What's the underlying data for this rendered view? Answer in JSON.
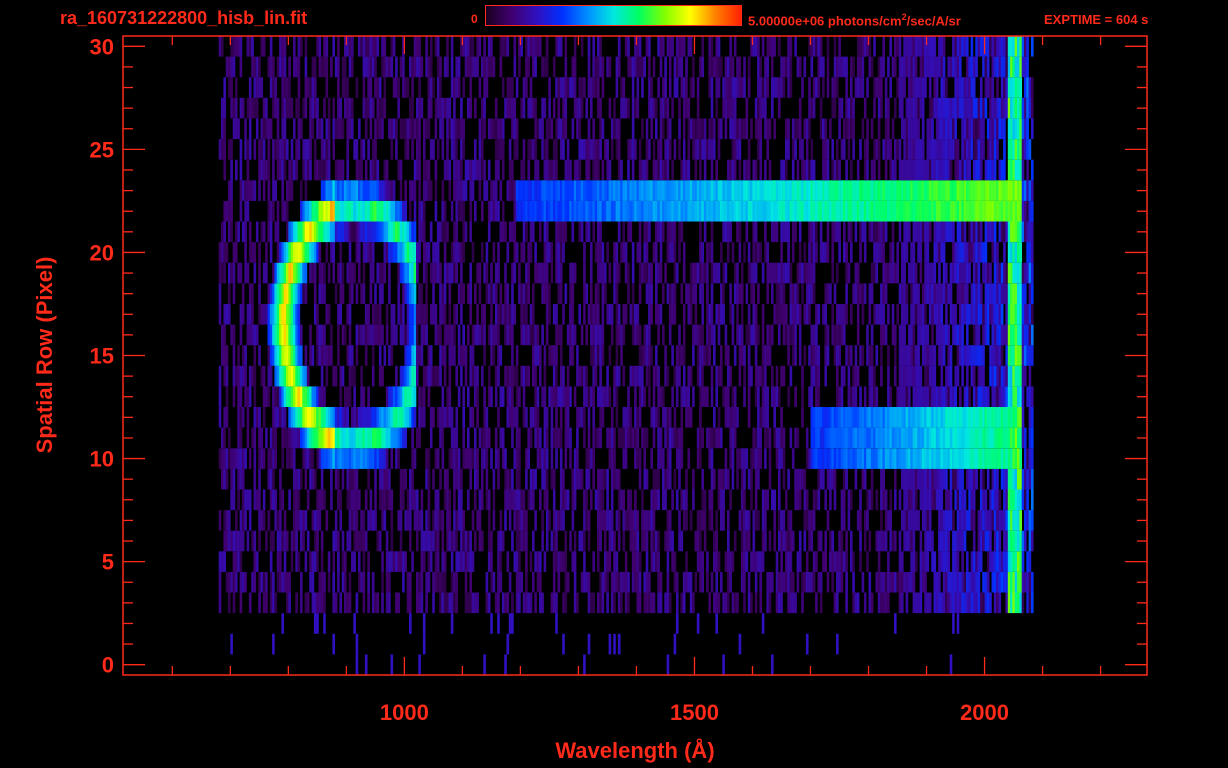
{
  "header": {
    "file_title": "ra_160731222800_hisb_lin.fit",
    "colorbar_min": "0",
    "colorbar_max_label": "5.00000e+06 photons/cm",
    "colorbar_unit_exp": "2",
    "colorbar_unit_tail": "/sec/A/sr",
    "exptime": "EXPTIME = 604 s"
  },
  "colors": {
    "axis": "#ff2a1a",
    "background": "#000000",
    "colormap": [
      "#1a0020",
      "#400070",
      "#3010c0",
      "#0030ff",
      "#0090ff",
      "#00e8e0",
      "#00ff60",
      "#80ff00",
      "#ffff00",
      "#ff8000",
      "#ff2000"
    ]
  },
  "chart_data": {
    "type": "heatmap",
    "title": "ra_160731222800_hisb_lin.fit",
    "xlabel": "Wavelength (Å)",
    "ylabel": "Spatial Row (Pixel)",
    "xlim": [
      515,
      2280
    ],
    "ylim": [
      -0.5,
      30.5
    ],
    "xticks": [
      1000,
      1500,
      2000
    ],
    "yticks": [
      0,
      5,
      10,
      15,
      20,
      25,
      30
    ],
    "colorbar_range": [
      0,
      5000000
    ],
    "colorbar_unit": "photons/cm^2/sec/A/sr",
    "data_x_range": [
      680,
      2080
    ],
    "data_rows": [
      0,
      30
    ],
    "features": [
      {
        "label": "arc",
        "x_range": [
          780,
          1020
        ],
        "rows": [
          11,
          22
        ],
        "peak_value": "high"
      },
      {
        "label": "band",
        "x_range": [
          1190,
          2060
        ],
        "rows": [
          22,
          23
        ],
        "peak_value": "medium-high"
      },
      {
        "label": "band",
        "x_range": [
          1700,
          2060
        ],
        "rows": [
          10,
          12
        ],
        "peak_value": "medium"
      },
      {
        "label": "edge",
        "x_range": [
          1960,
          2060
        ],
        "rows": [
          0,
          30
        ],
        "peak_value": "medium-high"
      }
    ]
  }
}
